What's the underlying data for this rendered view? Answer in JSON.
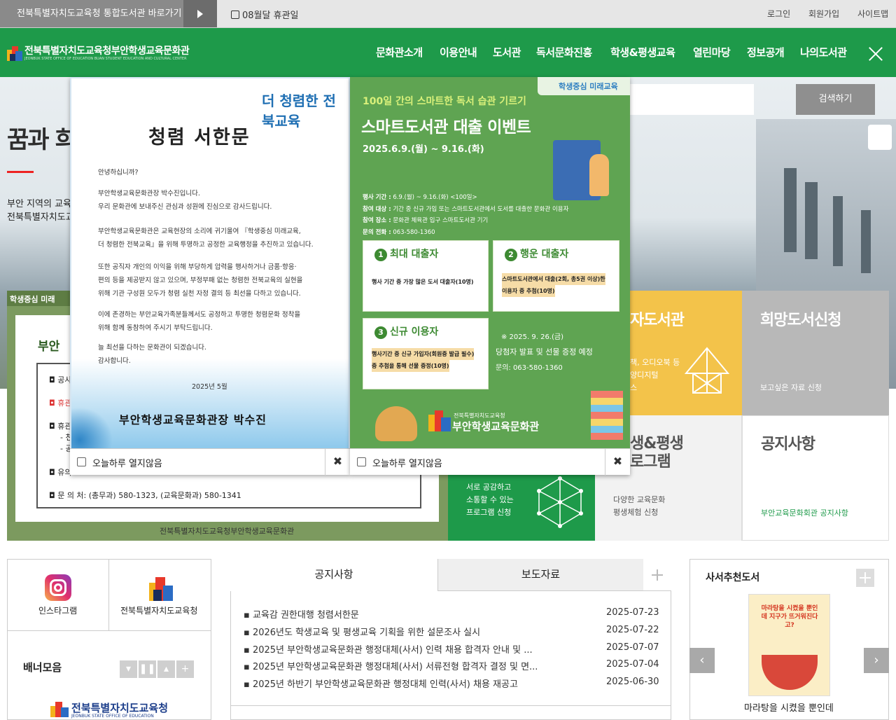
{
  "topbar": {
    "library_link": "전북특별자치도교육청 통합도서관 바로가기",
    "closed_day": "08월달 휴관일",
    "links": [
      "로그인",
      "회원가입",
      "사이트맵"
    ]
  },
  "header": {
    "logo_title": "전북특별자치도교육청부안학생교육문화관",
    "logo_sub": "JEONBUK STATE OFFICE OF EDUCATION BUAN STUDENT EDUCATION AND CULTURAL CENTER",
    "nav": [
      "문화관소개",
      "이용안내",
      "도서관",
      "독서문화진흥",
      "학생&평생교육",
      "열린마당",
      "정보공개",
      "나의도서관"
    ]
  },
  "hero": {
    "title": "꿈과 희",
    "desc1": "부안 지역의 교육",
    "desc2": "전북특별자치도교",
    "search_button": "검색하기"
  },
  "board": {
    "head": "부안",
    "lines": [
      "◘ 공사",
      "◘ 휴관",
      "◘ 휴관",
      "- 천",
      "- 공",
      "◘ 유의"
    ],
    "contact": "◘ 문 의 처: (총무과) 580-1323, (교육문화과) 580-1341",
    "footer": "전북특별자치도교육청부안학생교육문화관",
    "badge": "학생중심 미래"
  },
  "tiles": {
    "smart_title": "자도서관",
    "smart_desc1": "책, 오디오북 등",
    "smart_desc2": "양디지털",
    "smart_desc3": "스",
    "wish_title": "희망도서신청",
    "wish_desc": "보고싶은 자료 신청",
    "program_title1": "생&평생",
    "program_title2": "로그램",
    "program_desc1": "다양한 교육문화",
    "program_desc2": "평생체험 신청",
    "notice_title": "공지사항",
    "notice_desc": "부안교육문화회관 공지사항",
    "green_desc1": "서로 공감하고",
    "green_desc2": "소통할 수 있는",
    "green_desc3": "프로그램 신청"
  },
  "popup1": {
    "brand": "더 청렴한 전북교육",
    "title": "청렴 서한문",
    "lines": [
      "안녕하십니까?",
      "부안학생교육문화관장 박수진입니다.",
      "우리 문화관에 보내주신 관심과 성원에 진심으로   감사드립니다.",
      "부안학생교육문화관은 교육현장의 소리에 귀기울여 『학생중심 미래교육,",
      "더 청렴한 전북교육』을 위해 투명하고 공정한 교육행정을 추진하고 있습니다.",
      "또한 공직자 개인의 이익을 위해 부당하게 압력을 행사하거나 금품·향응·",
      "편의 등을 제공받지 않고 있으며, 부정부패 없는 청렴한 전북교육의 실현을",
      "위해 기관 구성원 모두가 청렴 실천 자정 결의 등 최선을 다하고 있습니다.",
      "이에 존경하는 부안교육가족분들께서도 공정하고 투명한 청렴문화 정착을",
      "위해 함께 동참하여 주시기 부탁드립니다.",
      "늘 최선을 다하는 문화관이 되겠습니다.",
      "감사합니다."
    ],
    "date": "2025년 5월",
    "signature": "부안학생교육문화관장 박수진",
    "dont_show": "오늘하루 열지않음",
    "close": "✖"
  },
  "popup2": {
    "badge": "학생중심 미래교육",
    "subtitle": "100일 간의 스마트한 독서 습관 기르기",
    "title": "스마트도서관 대출 이벤트",
    "period": "2025.6.9.(월) ~ 9.16.(화)",
    "info": [
      {
        "k": "행사 기간 :",
        "v": "6.9.(월) ~ 9.16.(화) <100일>"
      },
      {
        "k": "참여 대상 :",
        "v": "기간 중 신규 가입 또는 스마트도서관에서 도서를 대출한 문화관 이용자"
      },
      {
        "k": "참여 장소 :",
        "v": "문화관 체육관 입구 스마트도서관 기기"
      },
      {
        "k": "문의 전화 :",
        "v": "063-580-1360"
      }
    ],
    "card1_title": "최대 대출자",
    "card1_text": "행사 기간 중 가장 많은 도서 대출자(10명)",
    "card2_title": "행운 대출자",
    "card2_text1": "스마트도서관에서 대출(2회, 총5권 이상)한",
    "card2_text2": "이용자 중 추첨(10명)",
    "card3_title": "신규 이용자",
    "card3_text1": "행사기간 중 신규 가입자(회원증 발급 필수)",
    "card3_text2": "중 추첨을 통해 선물 증정(10명)",
    "note1": "※ 2025. 9. 26.(금)",
    "note2": "당첨자 발표 및 선물 증정 예정",
    "note3": "문의: 063-580-1360",
    "org_small": "전북특별자치도교육청",
    "org": "부안학생교육문화관",
    "dont_show": "오늘하루 열지않음",
    "close": "✖"
  },
  "quick": {
    "instagram": "인스타그램",
    "office": "전북특별자치도교육청",
    "banner_title": "배너모음",
    "banner_logo": "전북특별자치도교육청",
    "banner_logo_sub": "JEONBUK STATE OFFICE OF EDUCATION"
  },
  "news": {
    "tabs": [
      "공지사항",
      "보도자료"
    ],
    "items": [
      {
        "title": "교육감 권한대행 청렴서한문",
        "date": "2025-07-23"
      },
      {
        "title": "2026년도 학생교육 및 평생교육 기획을 위한 설문조사 실시",
        "date": "2025-07-22"
      },
      {
        "title": "2025년 부안학생교육문화관 행정대체(사서) 인력 채용 합격자 안내 및 ...",
        "date": "2025-07-07"
      },
      {
        "title": "2025년 부안학생교육문화관 행정대체(사서) 서류전형 합격자 결정 및 면...",
        "date": "2025-07-04"
      },
      {
        "title": "2025년 하반기 부안학생교육문화관 행정대체 인력(사서) 채용 재공고",
        "date": "2025-06-30"
      }
    ]
  },
  "recommend": {
    "title": "사서추천도서",
    "book_title": "마라탕을 시켰을 뿐인데",
    "cover_text": "마라탕을 시켰을 뿐인데 지구가 뜨거워진다고?"
  },
  "colors": {
    "brand_green": "#1e9a4a",
    "tile_yellow": "#f3c34a",
    "tile_gray": "#b8b8b8",
    "popup_green": "#5fa452"
  }
}
